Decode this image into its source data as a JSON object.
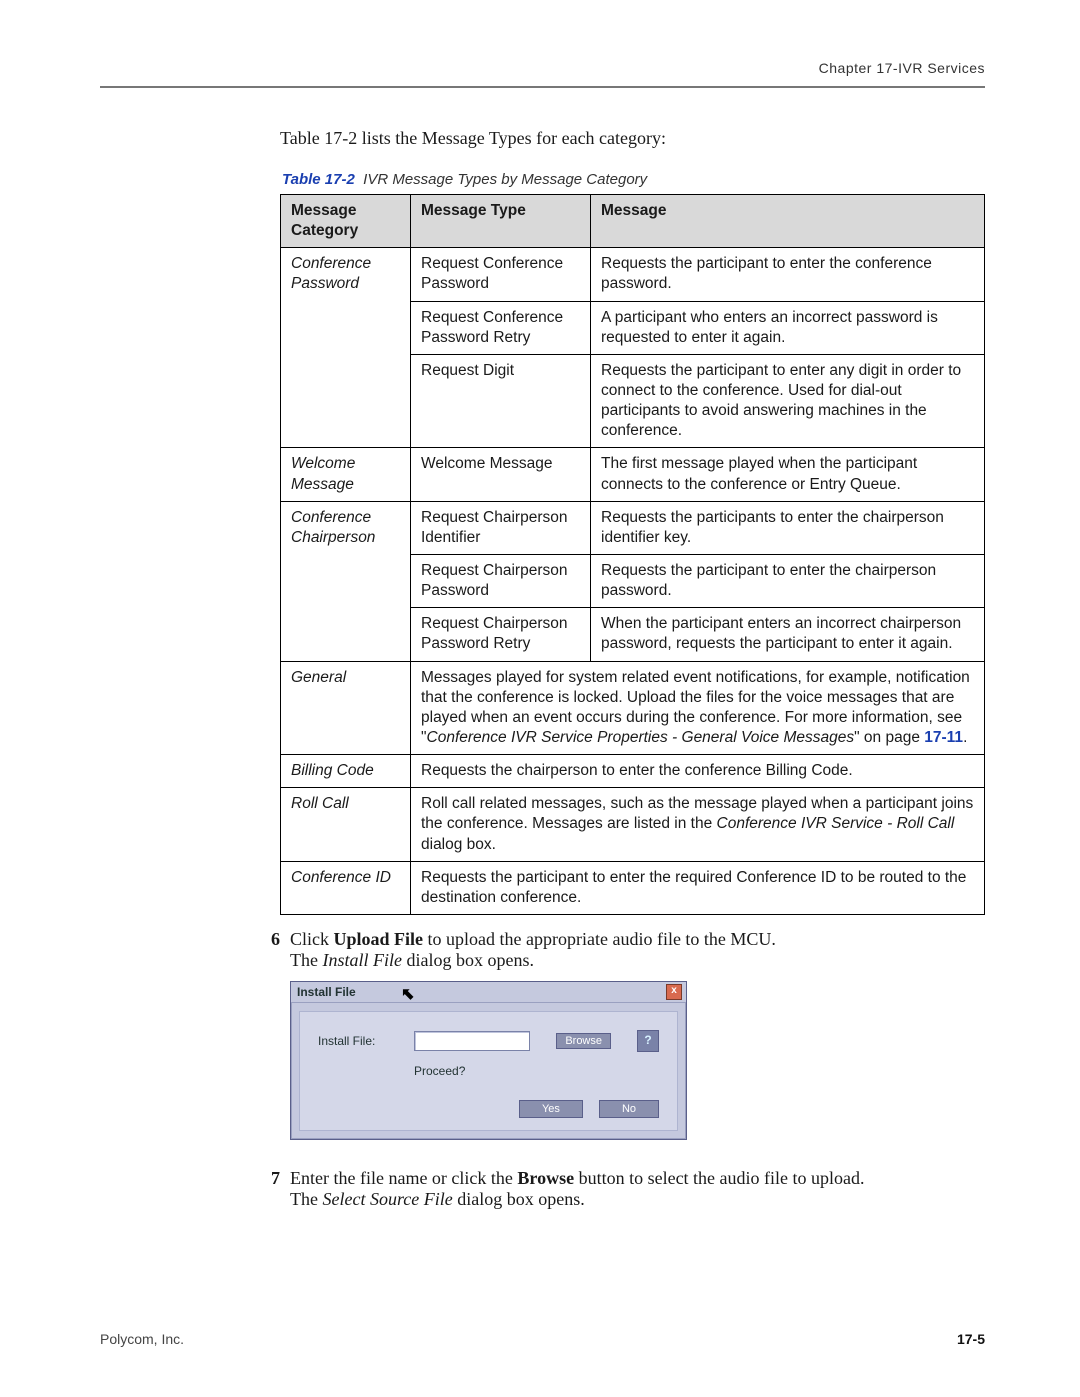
{
  "header": {
    "chapter": "Chapter 17-IVR Services"
  },
  "intro": "Table 17-2 lists the Message Types for each category:",
  "table": {
    "caption_num": "Table 17-2",
    "caption_title": "IVR Message Types by Message Category",
    "headers": {
      "c1": "Message Category",
      "c2": "Message Type",
      "c3": "Message"
    },
    "rows": {
      "confpw_cat": "Conference Password",
      "confpw_r1_t": "Request Conference Password",
      "confpw_r1_m": "Requests the participant to enter the conference password.",
      "confpw_r2_t": "Request Conference Password Retry",
      "confpw_r2_m": "A participant who enters an incorrect password is requested to enter it again.",
      "confpw_r3_t": "Request Digit",
      "confpw_r3_m": "Requests the participant to enter any digit in order to connect to the conference. Used for dial-out participants to avoid answering machines in the conference.",
      "welcome_cat": "Welcome Message",
      "welcome_t": "Welcome Message",
      "welcome_m": "The first message played when the participant connects to the conference or Entry Queue.",
      "chair_cat": "Conference Chairperson",
      "chair_r1_t": "Request Chairperson Identifier",
      "chair_r1_m": "Requests the participants to enter the chairperson identifier key.",
      "chair_r2_t": "Request Chairperson Password",
      "chair_r2_m": "Requests the participant to enter the chairperson password.",
      "chair_r3_t": "Request Chairperson Password Retry",
      "chair_r3_m": "When the participant enters an incorrect chairperson password, requests the participant to enter it again.",
      "general_cat": "General",
      "general_pre": "Messages played for system related event notifications, for example, notification that the conference is locked. Upload the files for the voice messages that are played when an event occurs during the conference. For more information, see \"",
      "general_ref": "Conference IVR Service Properties - General Voice Messages",
      "general_mid": "\" on page ",
      "general_link": "17-11",
      "general_post": ".",
      "billing_cat": "Billing Code",
      "billing_m": "Requests the chairperson to enter the conference Billing Code.",
      "roll_cat": "Roll Call",
      "roll_pre": "Roll call related messages, such as the message played when a participant joins the conference. Messages are listed in the ",
      "roll_ref": "Conference IVR Service - Roll Call",
      "roll_post": " dialog box.",
      "confid_cat": "Conference ID",
      "confid_m": "Requests the participant to enter the required Conference ID to be routed to the destination conference."
    }
  },
  "steps": {
    "s6_num": "6",
    "s6_a": "Click ",
    "s6_bold": "Upload File",
    "s6_b": " to upload the appropriate audio file to the MCU.",
    "s6_c": "The ",
    "s6_ital": "Install File",
    "s6_d": " dialog box opens.",
    "s7_num": "7",
    "s7_a": "Enter the file name or click the ",
    "s7_bold": "Browse",
    "s7_b": " button to select the audio file to upload.",
    "s7_c": "The ",
    "s7_ital": "Select Source File",
    "s7_d": " dialog box opens."
  },
  "dialog": {
    "title": "Install File",
    "field_label": "Install File:",
    "browse": "Browse",
    "help": "?",
    "proceed": "Proceed?",
    "yes": "Yes",
    "no": "No",
    "close": "x"
  },
  "footer": {
    "company": "Polycom, Inc.",
    "page": "17-5"
  }
}
